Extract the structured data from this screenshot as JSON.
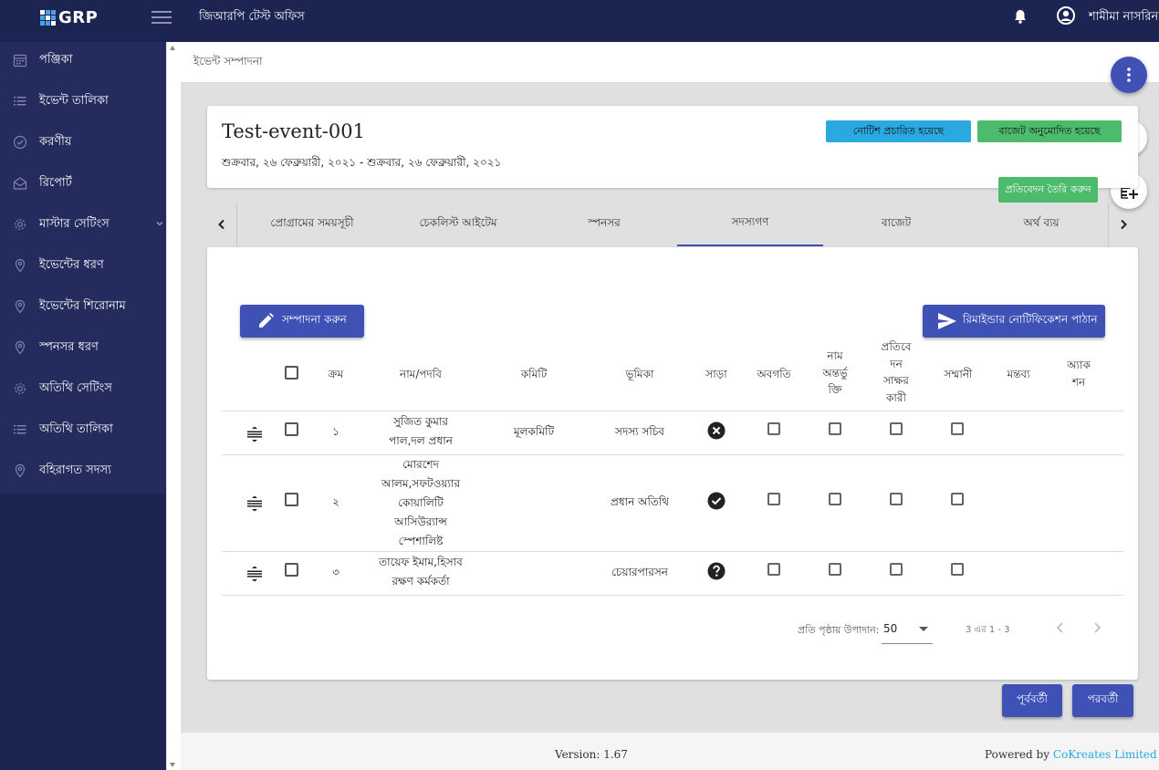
{
  "header": {
    "logo_text": "GRP",
    "office_title": "জিআরপি টেস্ট অফিস",
    "user_name": "শামীমা নাসরিন"
  },
  "sidebar": {
    "items": [
      {
        "label": "পঞ্জিকা",
        "icon": "calendar-icon"
      },
      {
        "label": "ইভেন্ট তালিকা",
        "icon": "list-icon"
      },
      {
        "label": "করণীয়",
        "icon": "check-circle-icon"
      },
      {
        "label": "রিপোর্ট",
        "icon": "mail-open-icon"
      },
      {
        "label": "মাস্টার সেটিংস",
        "icon": "gear-icon"
      },
      {
        "label": "ইভেন্টের ধরণ",
        "icon": "location-pin-icon"
      },
      {
        "label": "ইভেন্টের শিরোনাম",
        "icon": "location-pin-icon"
      },
      {
        "label": "স্পনসর ধরণ",
        "icon": "location-pin-icon"
      },
      {
        "label": "অতিথি সেটিংস",
        "icon": "gear-icon"
      },
      {
        "label": "অতিথি তালিকা",
        "icon": "list-icon"
      },
      {
        "label": "বহিরাগত সদস্য",
        "icon": "location-pin-icon"
      }
    ]
  },
  "breadcrumb": "ইভেন্ট সম্পাদনা",
  "event": {
    "title": "Test-event-001",
    "date_range": "শুক্রবার, ২৬ ফেব্রুয়ারী, ২০২১ - শুক্রবার, ২৬ ফেব্রুয়ারী, ২০২১",
    "badge_notice": "নোটিশ প্রচারিত হয়েছে",
    "badge_budget": "বাজেট অনুমোদিত হয়েছে",
    "badge_report": "প্রতিবেদন তৈরি করুন"
  },
  "tabs": [
    {
      "label": "প্রোগ্রামের সময়সূচী"
    },
    {
      "label": "চেকলিস্ট আইটেম"
    },
    {
      "label": "স্পনসর"
    },
    {
      "label": "সদস্যগণ",
      "active": true
    },
    {
      "label": "বাজেট"
    },
    {
      "label": "অর্থ ব্যয়"
    }
  ],
  "members": {
    "edit_button": "সম্পাদনা করুন",
    "remind_button": "রিমাইন্ডার নোটিফিকেশন পাঠান",
    "columns": {
      "serial": "ক্রম",
      "name": "নাম/পদবি",
      "committee": "কমিটি",
      "role": "ভূমিকা",
      "response": "সাড়া",
      "informed": "অবগতি",
      "name_include": [
        "নাম",
        "অন্তর্ভু",
        "ক্তি"
      ],
      "report_signer": [
        "প্রতিবে",
        "দন",
        "সাক্ষর",
        "কারী"
      ],
      "honorary": "সম্মানী",
      "comment": "মন্তব্য",
      "action": [
        "অ্যাক",
        "শন"
      ]
    },
    "rows": [
      {
        "serial": "১",
        "name": [
          "সুজিত কুমার",
          "পাল,দল প্রধান"
        ],
        "committee": "মূলকমিটি",
        "role": "সদস্য সচিব",
        "response": "declined"
      },
      {
        "serial": "২",
        "name": [
          "মোরশেদ",
          "আলম,সফটওয়্যার",
          "কোয়ালিটি",
          "আসিউর‍্যান্স",
          "স্পেশালিষ্ট"
        ],
        "committee": "",
        "role": "প্রধান অতিথি",
        "response": "accepted"
      },
      {
        "serial": "৩",
        "name": [
          "তায়েফ ইমাম,হিসাব",
          "রক্ষণ কর্মকর্তা"
        ],
        "committee": "",
        "role": "চেয়ারপারসন",
        "response": "unknown"
      }
    ]
  },
  "pagination": {
    "per_page_label": "প্রতি পৃষ্ঠায় উপাদান:",
    "per_page_value": "50",
    "range": "3 এর 1 - 3"
  },
  "nav": {
    "prev": "পূর্ববর্তী",
    "next": "পরবর্তী"
  },
  "footer": {
    "version": "Version: 1.67",
    "powered_by": "Powered by",
    "company": "CoKreates Limited"
  },
  "colors": {
    "sidebar": "#1c2452",
    "primary": "#3f51b5",
    "info": "#29a9e0",
    "success": "#4cbb6c"
  }
}
